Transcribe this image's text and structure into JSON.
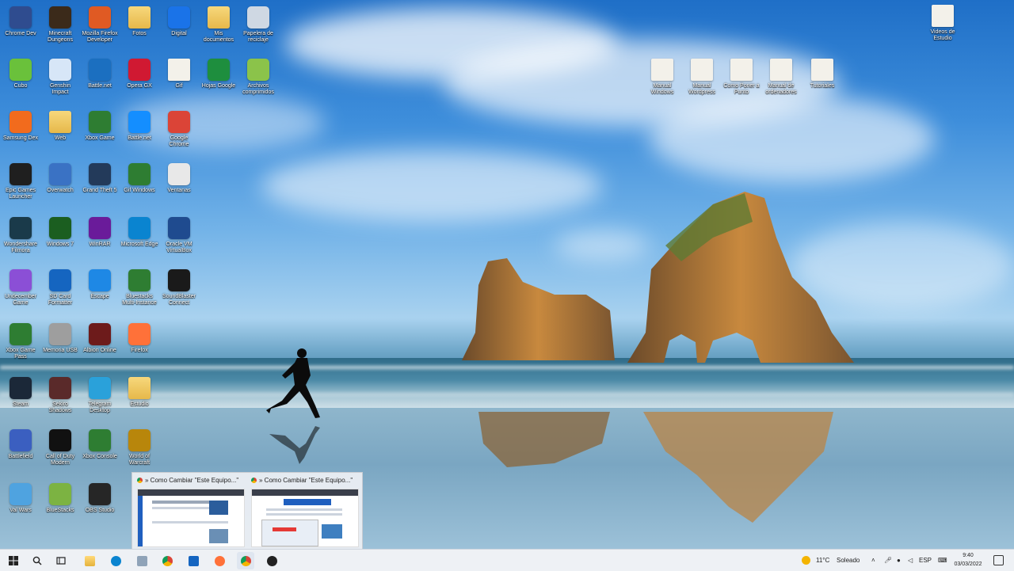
{
  "desktop": {
    "left_icons": [
      {
        "label": "Chrome Dev",
        "color": "#2f4c8f"
      },
      {
        "label": "Minecraft Dungeons",
        "color": "#3b2a1a"
      },
      {
        "label": "Mozilla Firefox Developer",
        "color": "#e05a23"
      },
      {
        "label": "Fotos",
        "color": "#ffd266",
        "kind": "folder"
      },
      {
        "label": "Digital",
        "color": "#1a73e8"
      },
      {
        "label": "Mis documentos",
        "color": "#ffd266",
        "kind": "folder"
      },
      {
        "label": "Papelera de reciclaje",
        "color": "#cfd8e3"
      },
      {
        "label": "Cubo",
        "color": "#6ac13b"
      },
      {
        "label": "Genshin Impact",
        "color": "#d7e6f7"
      },
      {
        "label": "Battle.net",
        "color": "#1b6fc0"
      },
      {
        "label": "Opera GX",
        "color": "#d01932"
      },
      {
        "label": "Gif",
        "color": "#f3f1ea",
        "kind": "file"
      },
      {
        "label": "Hojas Google",
        "color": "#1e8e3e"
      },
      {
        "label": "Archivos comprimidos",
        "color": "#8bc34a"
      },
      {
        "label": "Samsung Dex",
        "color": "#f26b1d"
      },
      {
        "label": "Web",
        "color": "#ffd266",
        "kind": "folder"
      },
      {
        "label": "Xbox Game",
        "color": "#2e7d32"
      },
      {
        "label": "Battle.net",
        "color": "#148eff"
      },
      {
        "label": "Google Chrome",
        "color": "#db4437"
      },
      {
        "label": "Epic Games Launcher",
        "color": "#1f1f1f"
      },
      {
        "label": "Overwatch",
        "color": "#3a72c4"
      },
      {
        "label": "Grand Theft 5",
        "color": "#233a5a"
      },
      {
        "label": "Gif Windows",
        "color": "#2e7d32"
      },
      {
        "label": "Ventanas",
        "color": "#e8e8e8"
      },
      {
        "label": "Wondershare Filmora",
        "color": "#1a3a4a"
      },
      {
        "label": "Windows 7",
        "color": "#1b5e20"
      },
      {
        "label": "WinRAR",
        "color": "#6a1b9a"
      },
      {
        "label": "Microsoft Edge",
        "color": "#0a84d0"
      },
      {
        "label": "Oracle VM VirtualBox",
        "color": "#1f4b8f"
      },
      {
        "label": "Undecember Game",
        "color": "#8b4fd6"
      },
      {
        "label": "SD Card Formatter",
        "color": "#1565c0"
      },
      {
        "label": "Escape",
        "color": "#1e88e5"
      },
      {
        "label": "Bluestacks Multi-Instance",
        "color": "#2e7d32"
      },
      {
        "label": "SoundBlaster Connect",
        "color": "#1a1a1a"
      },
      {
        "label": "Xbox Game Pass",
        "color": "#2e7d32"
      },
      {
        "label": "Memoria USB",
        "color": "#9e9e9e"
      },
      {
        "label": "Albion Online",
        "color": "#6d1b1b"
      },
      {
        "label": "Firefox",
        "color": "#ff7139"
      },
      {
        "label": "Steam",
        "color": "#1b2838"
      },
      {
        "label": "Sekiro Shadows",
        "color": "#5a2a2a"
      },
      {
        "label": "Telegram Desktop",
        "color": "#2aa1da"
      },
      {
        "label": "Estudio",
        "color": "#ffd266",
        "kind": "folder"
      },
      {
        "label": "Battlefield",
        "color": "#3b5fc0"
      },
      {
        "label": "Call of Duty Modern",
        "color": "#111111"
      },
      {
        "label": "Xbox Console",
        "color": "#2e7d32"
      },
      {
        "label": "World of Warcraft",
        "color": "#b8860b"
      },
      {
        "label": "Val Wars",
        "color": "#4fa3e0"
      },
      {
        "label": "BlueStacks",
        "color": "#7cb342"
      },
      {
        "label": "OBS Studio",
        "color": "#262626"
      }
    ],
    "right_icons": [
      {
        "label": "Videos de Estudio",
        "kind": "file"
      },
      {
        "label": "Manual Windows",
        "kind": "file"
      },
      {
        "label": "Manual Wordpress",
        "kind": "file"
      },
      {
        "label": "Como Poner a Punto",
        "kind": "file"
      },
      {
        "label": "Manual de ordenadores",
        "kind": "file"
      },
      {
        "label": "Tutoriales",
        "kind": "file"
      }
    ]
  },
  "previews": [
    {
      "title": "» Como Cambiar \"Este Equipo...\""
    },
    {
      "title": "» Como Cambiar \"Este Equipo...\""
    }
  ],
  "taskbar": {
    "weather_temp": "11°C",
    "weather_desc": "Soleado",
    "clock_time": "9:40",
    "clock_date": "03/03/2022",
    "tray_lang": "ESP",
    "apps": [
      "file-explorer",
      "edge",
      "chrome",
      "mail",
      "firefox",
      "chrome-active",
      "obs"
    ]
  }
}
